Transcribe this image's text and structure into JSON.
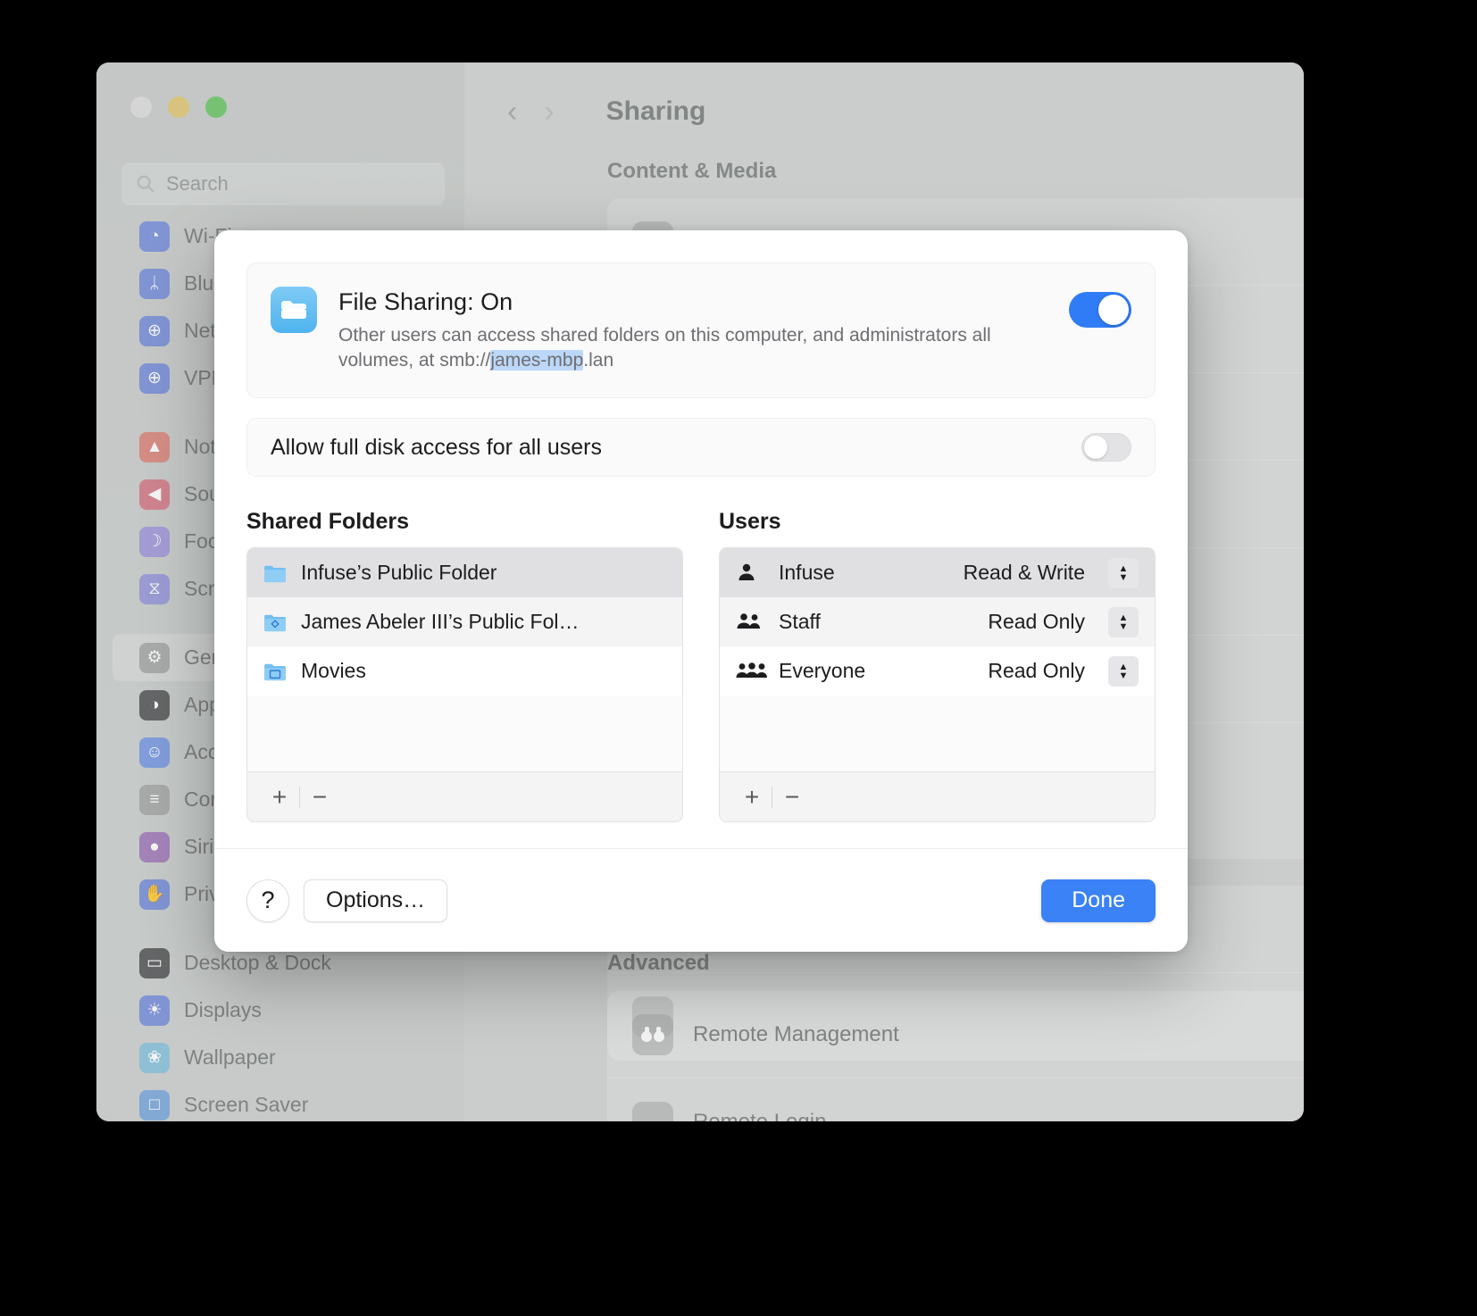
{
  "window": {
    "title": "Sharing",
    "search_placeholder": "Search",
    "nav": {
      "back": "‹",
      "forward": "›"
    },
    "sections": [
      {
        "heading": "Content & Media"
      },
      {
        "heading": "Advanced"
      }
    ],
    "advanced_rows": [
      {
        "label": "Remote Management",
        "icon": "binoculars-icon"
      },
      {
        "label": "Remote Login",
        "icon": "terminal-icon"
      }
    ],
    "sidebar_items": [
      {
        "label": "Wi-Fi",
        "icon": "wifi-icon",
        "color": "#6d85d8",
        "selected": false
      },
      {
        "label": "Bluetooth",
        "icon": "bluetooth-icon",
        "color": "#6d85d8",
        "selected": false
      },
      {
        "label": "Network",
        "icon": "globe-icon",
        "color": "#6d85d8",
        "selected": false
      },
      {
        "label": "VPN",
        "icon": "vpn-globe-icon",
        "color": "#6d85d8",
        "selected": false
      },
      {
        "label": "Notifications",
        "icon": "bell-icon",
        "color": "#d87b72",
        "selected": false
      },
      {
        "label": "Sound",
        "icon": "speaker-icon",
        "color": "#d0707f",
        "selected": false
      },
      {
        "label": "Focus",
        "icon": "moon-icon",
        "color": "#9a8fd8",
        "selected": false
      },
      {
        "label": "Screen Time",
        "icon": "hourglass-icon",
        "color": "#8f8fd8",
        "selected": false
      },
      {
        "label": "General",
        "icon": "gear-icon",
        "color": "#9ea1a0",
        "selected": true
      },
      {
        "label": "Appearance",
        "icon": "contrast-icon",
        "color": "#4a4a4c",
        "selected": false
      },
      {
        "label": "Accessibility",
        "icon": "accessibility-icon",
        "color": "#6d90e0",
        "selected": false
      },
      {
        "label": "Control Center",
        "icon": "sliders-icon",
        "color": "#9ea1a0",
        "selected": false
      },
      {
        "label": "Siri & Spotlight",
        "icon": "siri-icon",
        "color": "#9a6fb5",
        "selected": false
      },
      {
        "label": "Privacy & Security",
        "icon": "hand-icon",
        "color": "#6d85d8",
        "selected": false
      },
      {
        "label": "Desktop & Dock",
        "icon": "dock-icon",
        "color": "#4a4a4c",
        "selected": false
      },
      {
        "label": "Displays",
        "icon": "brightness-icon",
        "color": "#6d85d8",
        "selected": false
      },
      {
        "label": "Wallpaper",
        "icon": "flower-icon",
        "color": "#7fbcd8",
        "selected": false
      },
      {
        "label": "Screen Saver",
        "icon": "screensaver-icon",
        "color": "#6d9fd8",
        "selected": false
      }
    ]
  },
  "sheet": {
    "file_sharing": {
      "title": "File Sharing: On",
      "desc_before": "Other users can access shared folders on this computer, and administrators all volumes, at smb://",
      "desc_highlight": "james-mbp",
      "desc_after": ".lan",
      "toggle_state": "on",
      "icon": "folder-icon"
    },
    "full_disk_access": {
      "label": "Allow full disk access for all users",
      "toggle_state": "off"
    },
    "shared_folders": {
      "title": "Shared Folders",
      "items": [
        {
          "name": "Infuse’s Public Folder",
          "icon": "folder-icon",
          "selected": true
        },
        {
          "name": "James Abeler III’s Public Fol…",
          "icon": "folder-public-icon",
          "selected": false
        },
        {
          "name": "Movies",
          "icon": "folder-movies-icon",
          "selected": false
        }
      ],
      "add_label": "+",
      "remove_label": "−"
    },
    "users": {
      "title": "Users",
      "items": [
        {
          "name": "Infuse",
          "permission": "Read & Write",
          "icon": "person-icon",
          "selected": true
        },
        {
          "name": "Staff",
          "permission": "Read Only",
          "icon": "two-people-icon",
          "selected": false
        },
        {
          "name": "Everyone",
          "permission": "Read Only",
          "icon": "three-people-icon",
          "selected": false
        }
      ],
      "add_label": "+",
      "remove_label": "−"
    },
    "footer": {
      "help_label": "?",
      "options_label": "Options…",
      "done_label": "Done"
    }
  },
  "colors": {
    "accent_blue": "#3b82f6",
    "toggle_on": "#2f7cf6",
    "highlight": "#bcd7f7"
  }
}
